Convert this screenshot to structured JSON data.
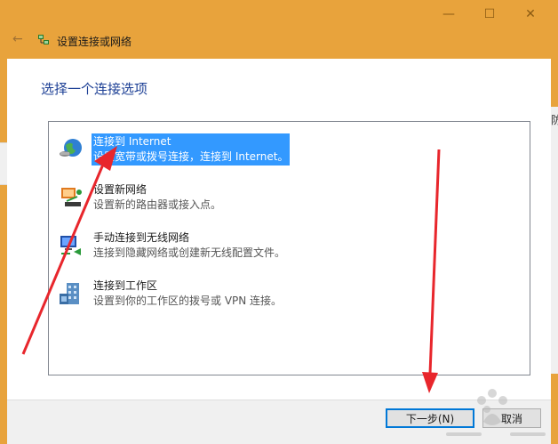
{
  "window": {
    "title": "设置连接或网络",
    "minimize_glyph": "—",
    "maximize_glyph": "☐",
    "close_glyph": "✕",
    "back_glyph": "←",
    "titlebar_color": "#e8a33c"
  },
  "background_app": {
    "right_glyph": "防"
  },
  "heading": "选择一个连接选项",
  "options": [
    {
      "title": "连接到 Internet",
      "description": "设置宽带或拨号连接，连接到 Internet。",
      "icon": "globe-internet-icon",
      "selected": true
    },
    {
      "title": "设置新网络",
      "description": "设置新的路由器或接入点。",
      "icon": "new-network-icon",
      "selected": false
    },
    {
      "title": "手动连接到无线网络",
      "description": "连接到隐藏网络或创建新无线配置文件。",
      "icon": "wireless-network-icon",
      "selected": false
    },
    {
      "title": "连接到工作区",
      "description": "设置到你的工作区的拨号或 VPN 连接。",
      "icon": "workplace-icon",
      "selected": false
    }
  ],
  "buttons": {
    "next": "下一步(N)",
    "cancel": "取消"
  },
  "colors": {
    "selection": "#3399ff",
    "heading": "#1c3f95",
    "annotation": "#e8262c",
    "focus_border": "#0078d7"
  }
}
